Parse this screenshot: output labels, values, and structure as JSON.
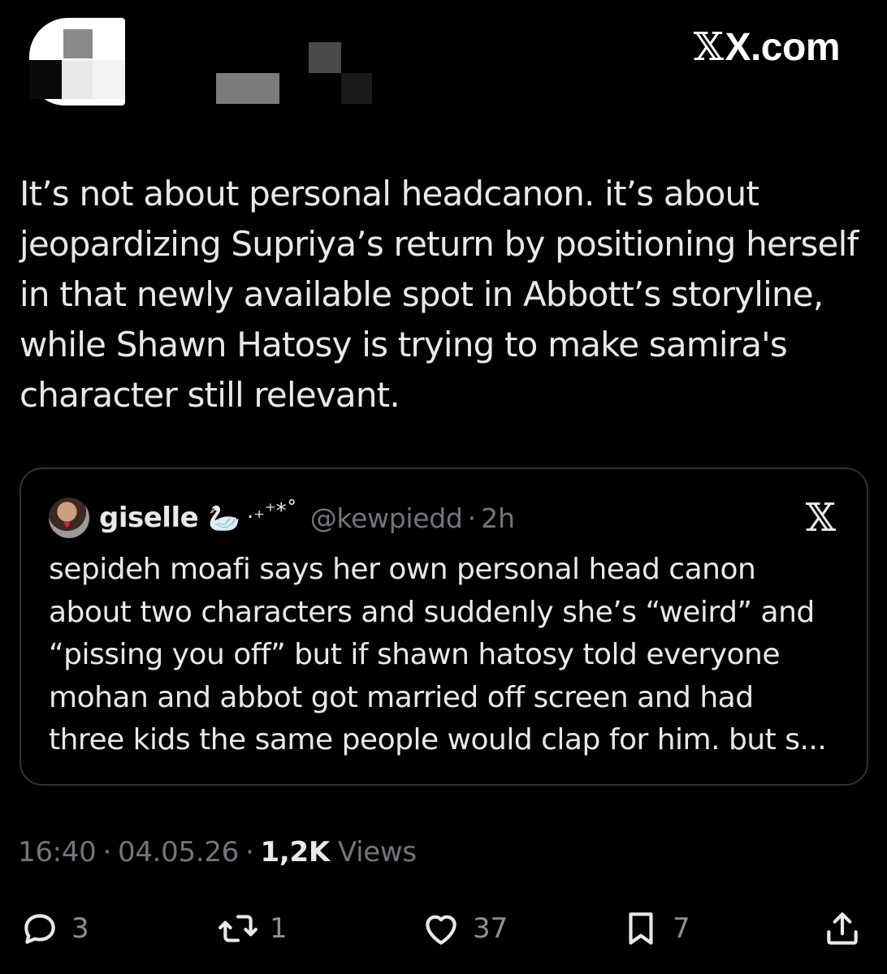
{
  "header": {
    "brand": "X.com"
  },
  "post": {
    "text": "It’s not about personal headcanon. it’s about\njeopardizing Supriya’s return by positioning herself\nin that newly available spot in Abbott’s storyline,\nwhile Shawn Hatosy is trying to make samira's\ncharacter still relevant."
  },
  "quote": {
    "name": "giselle",
    "emoji": "🦢",
    "sparkle": ".₊⁺*˚",
    "handle": "@kewpiedd",
    "dot": "·",
    "time": "2h",
    "text": "sepideh moafi says her own personal head canon\nabout two characters and suddenly she’s “weird” and\n“pissing you off” but if shawn hatosy told everyone\nmohan and abbot got married off screen and had\nthree kids the same people would clap for him. but s..."
  },
  "meta": {
    "time": "16:40",
    "sep1": "·",
    "date": "04.05.26",
    "sep2": "·",
    "views_count": "1,2K",
    "views_label": "Views"
  },
  "actions": {
    "replies": "3",
    "reposts": "1",
    "likes": "37",
    "bookmarks": "7"
  },
  "icons": {
    "reply": "reply-icon",
    "repost": "repost-icon",
    "like": "heart-icon",
    "bookmark": "bookmark-icon",
    "share": "share-icon"
  }
}
